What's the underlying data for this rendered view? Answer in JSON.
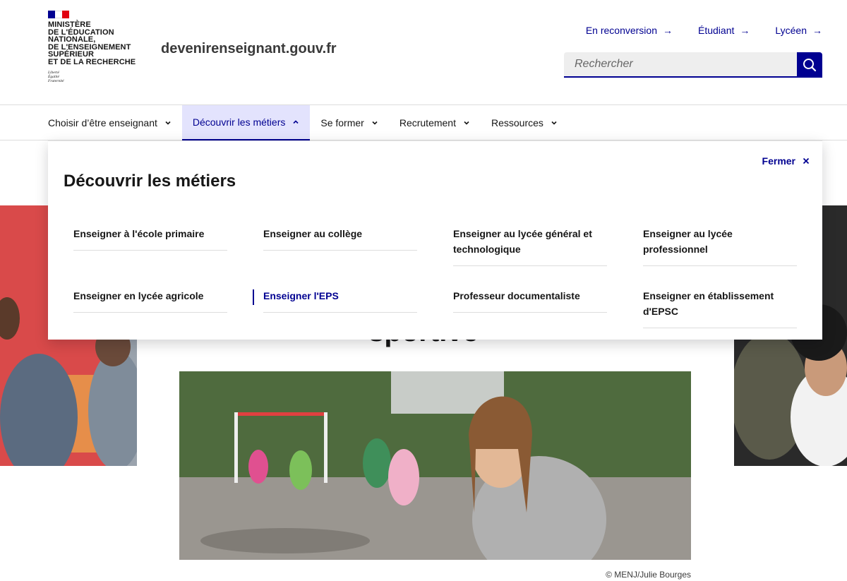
{
  "brand": {
    "logo_lines": [
      "Ministère",
      "de l'Éducation",
      "nationale,",
      "de l'Enseignement",
      "supérieur",
      "et de la Recherche"
    ],
    "motto_lines": [
      "Liberté",
      "Égalité",
      "Fraternité"
    ],
    "site_name": "devenirenseignant.gouv.fr",
    "flag_colors": [
      "#000091",
      "#ffffff",
      "#e1000f"
    ]
  },
  "quick_links": [
    {
      "label": "En reconversion",
      "icon": "arrow-right-icon"
    },
    {
      "label": "Étudiant",
      "icon": "arrow-right-icon"
    },
    {
      "label": "Lycéen",
      "icon": "arrow-right-icon"
    }
  ],
  "search": {
    "placeholder": "Rechercher",
    "value": "",
    "button_icon": "search-icon"
  },
  "nav": {
    "items": [
      {
        "label": "Choisir d’être enseignant",
        "expanded": false
      },
      {
        "label": "Découvrir les métiers",
        "expanded": true
      },
      {
        "label": "Se former",
        "expanded": false
      },
      {
        "label": "Recrutement",
        "expanded": false
      },
      {
        "label": "Ressources",
        "expanded": false
      }
    ]
  },
  "mega_menu": {
    "title": "Découvrir les métiers",
    "close_label": "Fermer",
    "close_icon": "close-icon",
    "links": [
      {
        "label": "Enseigner à l'école primaire",
        "current": false
      },
      {
        "label": "Enseigner au collège",
        "current": false
      },
      {
        "label": "Enseigner au lycée général et technologique",
        "current": false
      },
      {
        "label": "Enseigner au lycée professionnel",
        "current": false
      },
      {
        "label": "Enseigner en lycée agricole",
        "current": false
      },
      {
        "label": "Enseigner l'EPS",
        "current": true
      },
      {
        "label": "Professeur documentaliste",
        "current": false
      },
      {
        "label": "Enseigner en établissement d'EPSC",
        "current": false
      }
    ]
  },
  "page": {
    "title_fragment": "sportive",
    "photo_credit": "© MENJ/Julie Bourges"
  },
  "colors": {
    "primary": "#000091",
    "accent_red": "#e1000f",
    "active_tab_bg": "#e3e3fd",
    "divider": "#dddddd"
  }
}
